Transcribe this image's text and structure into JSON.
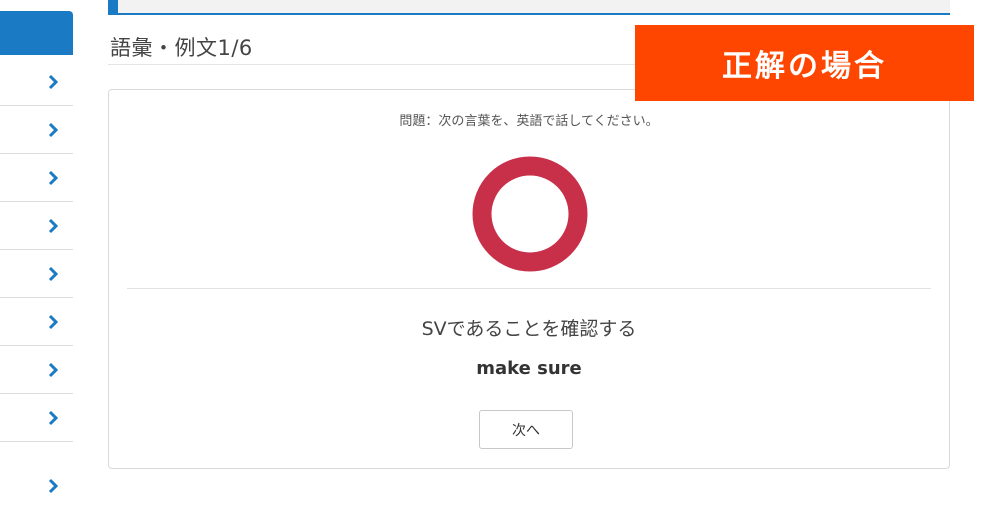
{
  "header": {
    "section_title": "語彙・例文1/6"
  },
  "overlay": {
    "label": "正解の場合",
    "color": "#ff4600"
  },
  "sidebar": {
    "accent_color": "#1a7ac4",
    "rows": [
      {
        "icon": "chevron-right-icon"
      },
      {
        "icon": "chevron-right-icon"
      },
      {
        "icon": "chevron-right-icon"
      },
      {
        "icon": "chevron-right-icon"
      },
      {
        "icon": "chevron-right-icon"
      },
      {
        "icon": "chevron-right-icon"
      },
      {
        "icon": "chevron-right-icon"
      },
      {
        "icon": "chevron-right-icon"
      },
      {
        "icon": "chevron-right-icon"
      }
    ]
  },
  "quiz": {
    "prompt": "問題：次の言葉を、英語で話してください。",
    "result_icon": "correct-circle-icon",
    "result_color": "#c8304a",
    "meaning": "SVであることを確認する",
    "answer": "make sure",
    "next_button": "次へ"
  }
}
